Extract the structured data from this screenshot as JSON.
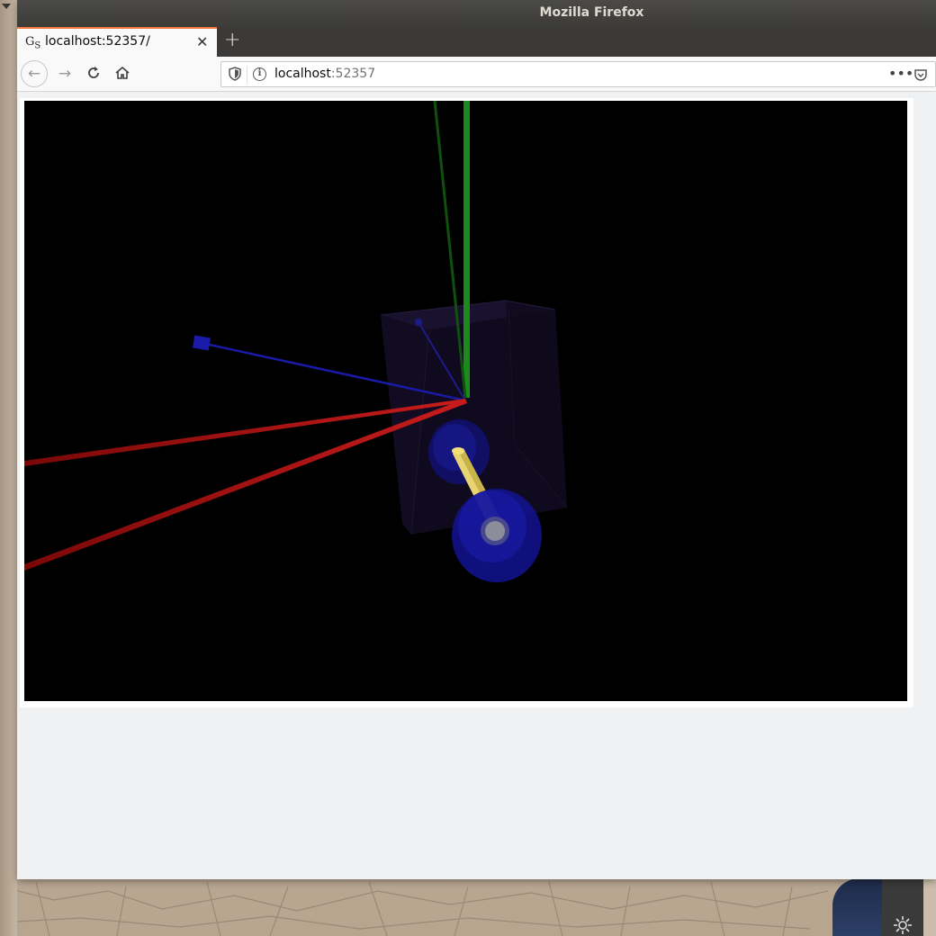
{
  "window": {
    "title": "Mozilla Firefox"
  },
  "tab": {
    "favicon": "G",
    "favicon_sub": "S",
    "title": "localhost:52357/",
    "close_icon": "close-icon"
  },
  "navbar": {
    "back_icon": "arrow-left-icon",
    "forward_icon": "arrow-right-icon",
    "reload_icon": "reload-icon",
    "home_icon": "home-icon"
  },
  "urlbar": {
    "host": "localhost",
    "port": ":52357",
    "more_label": "•••"
  },
  "scene": {
    "background": "#000000",
    "axis_colors": {
      "x": "#b01010",
      "y": "#1d8a1d",
      "z": "#1a1aa8"
    },
    "box_color": "#1a1230",
    "cylinder_color": "#c8b44a",
    "wheel_color": "#1818a0"
  },
  "desktop": {
    "settings_icon": "gear-icon"
  }
}
